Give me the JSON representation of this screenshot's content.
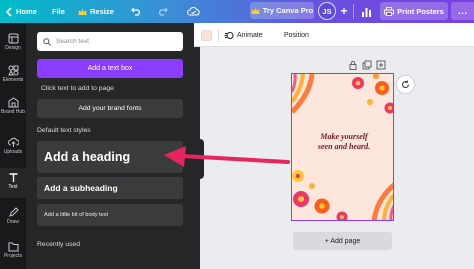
{
  "topbar": {
    "home": "Home",
    "file": "File",
    "resize": "Resize",
    "try_canva_pro": "Try Canva Pro",
    "avatar_initials": "JS",
    "plus": "+",
    "print_posters": "Print Posters",
    "more": "…"
  },
  "rail": {
    "items": [
      {
        "label": "Design",
        "icon": "design-icon"
      },
      {
        "label": "Elements",
        "icon": "elements-icon"
      },
      {
        "label": "Brand Hub",
        "icon": "brand-hub-icon"
      },
      {
        "label": "Uploads",
        "icon": "uploads-icon"
      },
      {
        "label": "Text",
        "icon": "text-icon",
        "active": true
      },
      {
        "label": "Draw",
        "icon": "draw-icon"
      },
      {
        "label": "Projects",
        "icon": "projects-icon"
      }
    ]
  },
  "panel": {
    "search_placeholder": "Search text",
    "add_text_box": "Add a text box",
    "click_text": "Click text to add to page",
    "brand_fonts": "Add your brand fonts",
    "default_styles": "Default text styles",
    "add_heading": "Add a heading",
    "add_subheading": "Add a subheading",
    "add_body": "Add a little bit of body text",
    "recently_used": "Recently used"
  },
  "toolbar": {
    "animate": "Animate",
    "position": "Position",
    "swatch_color": "#fde3da"
  },
  "canvas": {
    "page_text_line1": "Make yourself",
    "page_text_line2": "seen and heard.",
    "add_page": "+ Add page",
    "page_bg": "#fde6dc",
    "selection_color": "#8b3dff"
  },
  "colors": {
    "accent": "#8b3dff",
    "arrow": "#e8245e",
    "panel_bg": "#252627",
    "rail_bg": "#18191b"
  }
}
